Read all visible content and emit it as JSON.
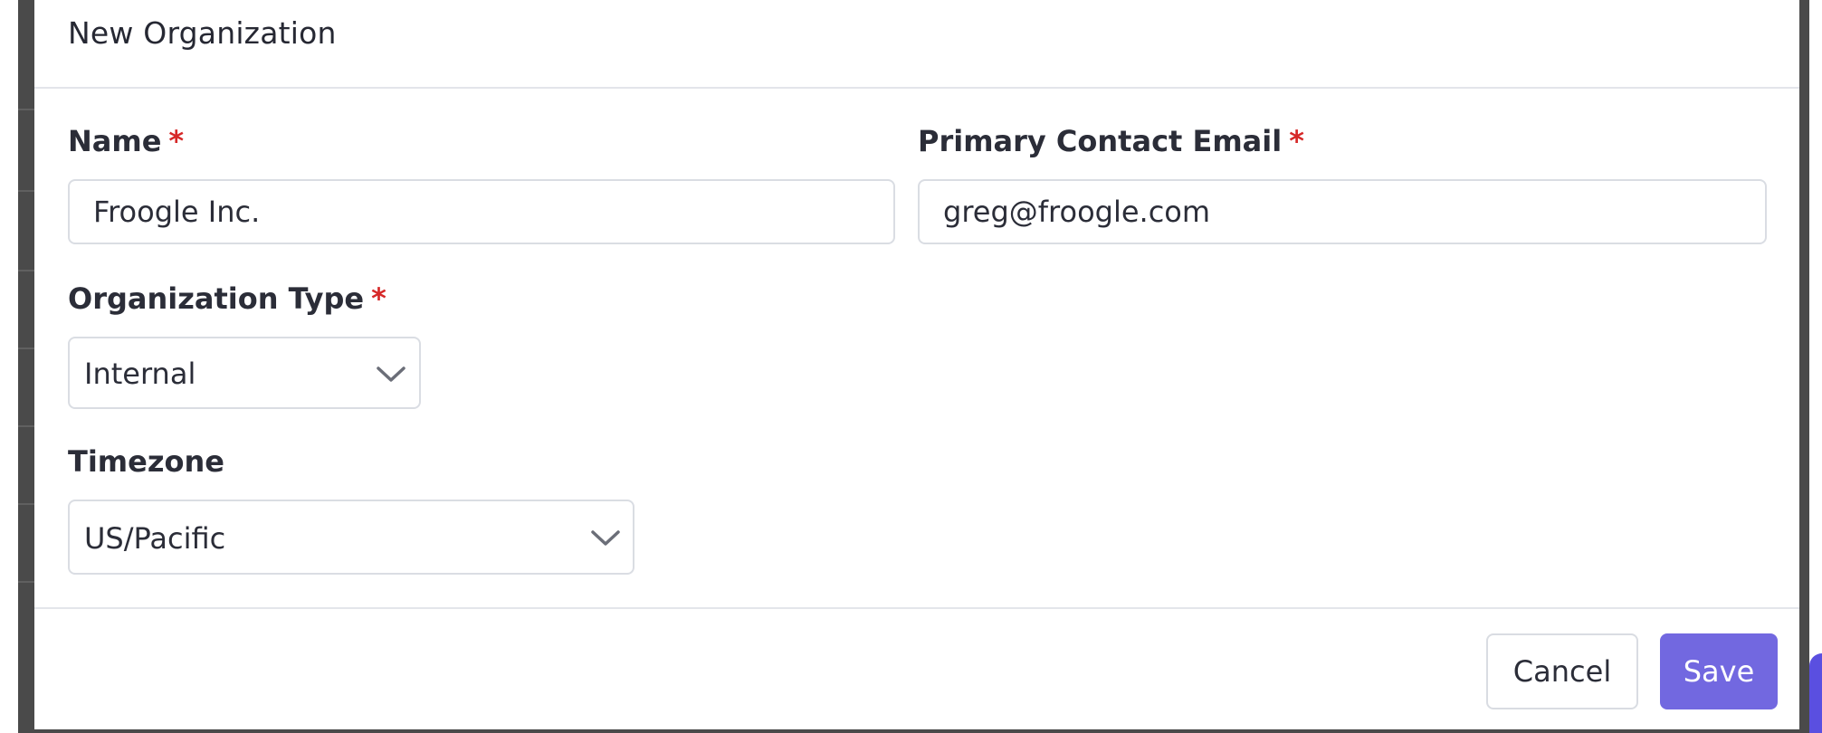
{
  "dialog": {
    "title": "New Organization"
  },
  "form": {
    "name": {
      "label": "Name",
      "required_mark": "*",
      "value": "Froogle Inc."
    },
    "primary_contact_email": {
      "label": "Primary Contact Email",
      "required_mark": "*",
      "value": "greg@froogle.com"
    },
    "organization_type": {
      "label": "Organization Type",
      "required_mark": "*",
      "selected": "Internal",
      "icon": "chevron-down-icon"
    },
    "timezone": {
      "label": "Timezone",
      "selected": "US/Pacific",
      "icon": "chevron-down-icon"
    }
  },
  "footer": {
    "cancel_label": "Cancel",
    "save_label": "Save"
  },
  "colors": {
    "accent": "#7268e0",
    "required": "#d62828",
    "border": "#dadde3",
    "text": "#2b2d38"
  }
}
